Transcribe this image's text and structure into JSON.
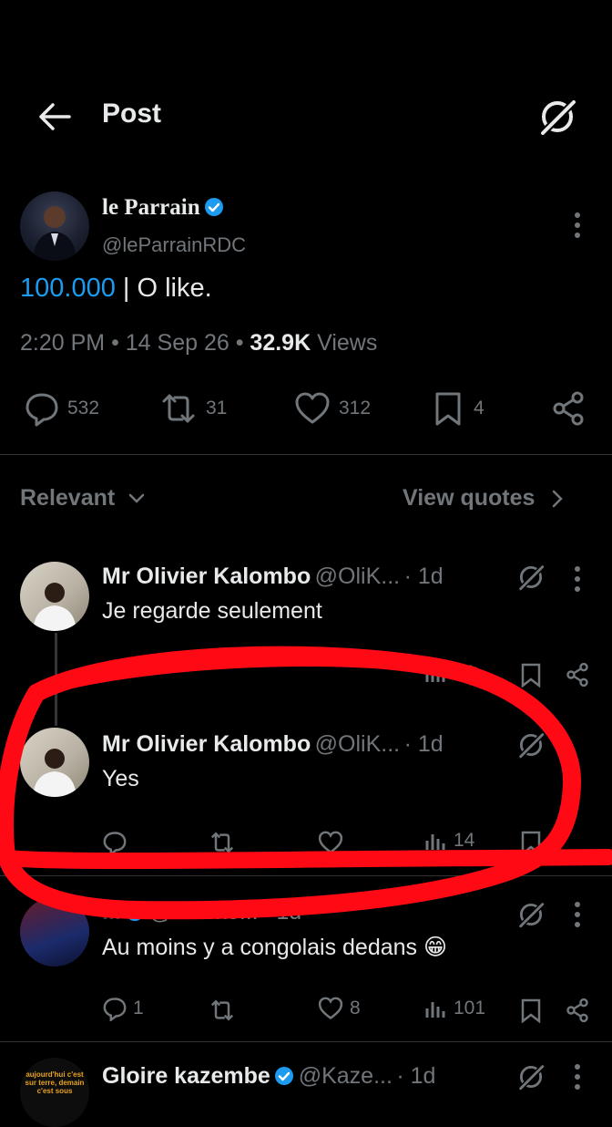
{
  "header": {
    "title": "Post"
  },
  "post": {
    "author_name": "le Parrain",
    "author_handle": "@leParrainRDC",
    "text_link": "100.000",
    "text_rest": " | O like.",
    "time": "2:20 PM",
    "date": "14 Sep 26",
    "views_count": "32.9K",
    "views_label": "Views",
    "replies": "532",
    "reposts": "31",
    "likes": "312",
    "bookmarks": "4"
  },
  "sort": {
    "label": "Relevant",
    "quotes": "View quotes"
  },
  "replies": [
    {
      "name": "Mr Olivier Kalombo",
      "handle": "@OliK...",
      "time": "· 1d",
      "text": "Je regarde seulement",
      "views": "72"
    },
    {
      "name": "Mr Olivier Kalombo",
      "handle": "@OliK...",
      "time": "· 1d",
      "text": "Yes",
      "views": "14"
    },
    {
      "name": "...",
      "handle": "@Idrisko...",
      "time": "· 1d",
      "text": "Au moins y a congolais dedans 😁",
      "replies": "1",
      "likes": "8",
      "views": "101"
    },
    {
      "name": "Gloire kazembe",
      "handle": "@Kaze...",
      "time": "· 1d",
      "avatar_text": "aujourd'hui c'est sur terre, demain c'est sous"
    }
  ],
  "colors": {
    "accent": "#1d9bf0",
    "muted": "#71767b",
    "annotation": "#ff0a14"
  }
}
